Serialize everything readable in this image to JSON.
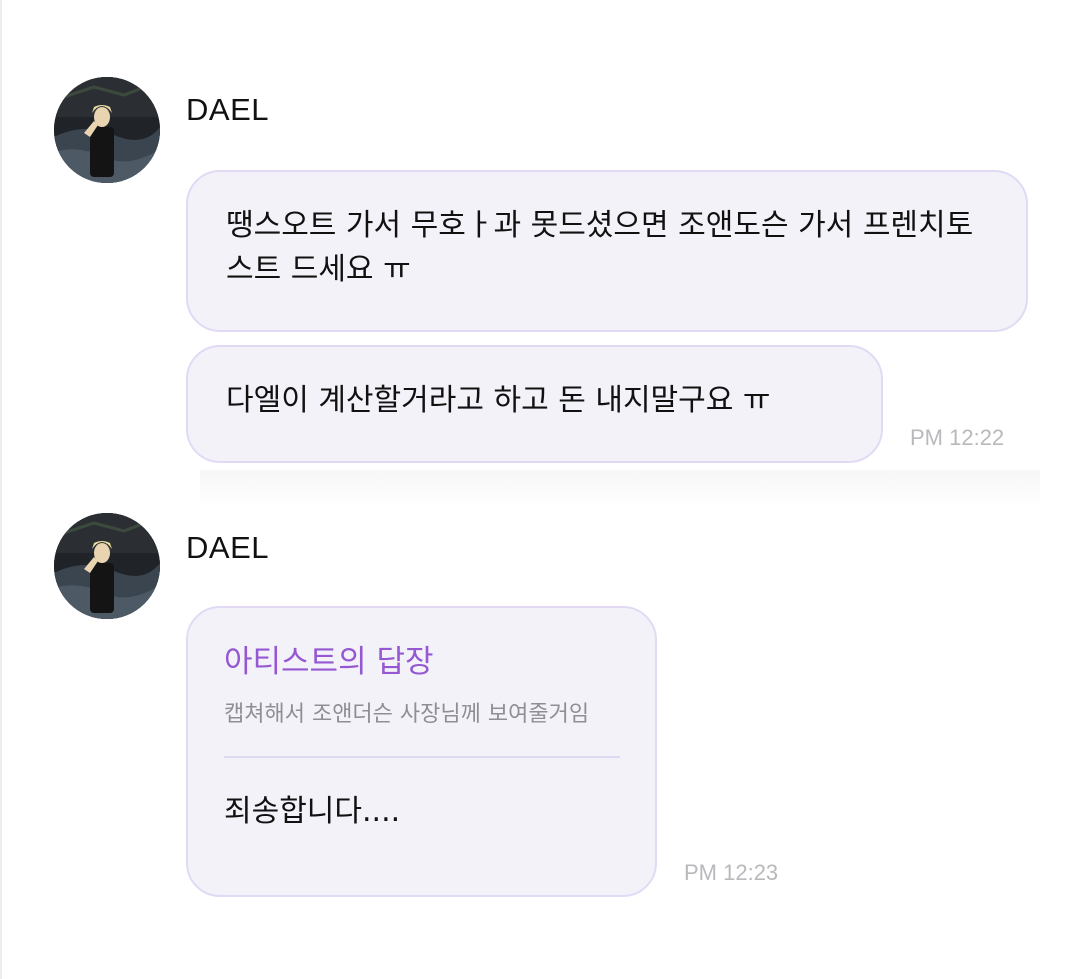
{
  "messages": [
    {
      "sender": "DAEL",
      "bubbles": [
        "땡스오트 가서 무호ㅏ과 못드셨으면 조앤도슨 가서 프렌치토스트 드세요 ㅠ",
        "다엘이 계산할거라고 하고 돈 내지말구요 ㅠ"
      ],
      "time": "PM 12:22"
    },
    {
      "sender": "DAEL",
      "reply": {
        "title": "아티스트의 답장",
        "quote": "캡쳐해서 조앤더슨 사장님께 보여줄거임",
        "body": "죄송합니다...."
      },
      "time": "PM 12:23"
    }
  ],
  "colors": {
    "bubble_bg": "#f3f2f9",
    "bubble_border": "#e2daf5",
    "reply_title": "#9657d3",
    "timestamp": "#b9b9bd"
  },
  "icons": {
    "avatar": "profile-photo-avatar"
  }
}
